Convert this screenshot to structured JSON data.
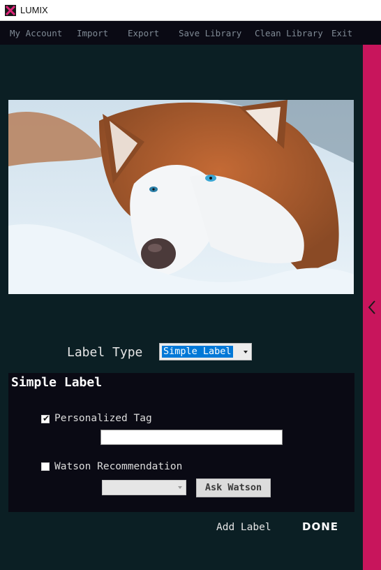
{
  "window": {
    "title": "LUMIX"
  },
  "menu": {
    "items": [
      "My Account",
      "Import",
      "Export",
      "Save Library",
      "Clean Library",
      "Exit"
    ]
  },
  "image": {
    "subject": "husky"
  },
  "label_type": {
    "label": "Label Type",
    "selected": "Simple Label"
  },
  "simple_label": {
    "title": "Simple Label",
    "personalized_tag": {
      "label": "Personalized Tag",
      "checked": true,
      "value": ""
    },
    "watson": {
      "label": "Watson Recommendation",
      "checked": false,
      "selected": ""
    },
    "ask_button": "Ask Watson"
  },
  "actions": {
    "add_label": "Add Label",
    "done": "DONE"
  },
  "colors": {
    "accent": "#c8155c",
    "background": "#0b1f24",
    "menubar": "#0a0a14",
    "selection": "#0078d7"
  },
  "icons": {
    "side_toggle": "chevron-left-icon"
  }
}
